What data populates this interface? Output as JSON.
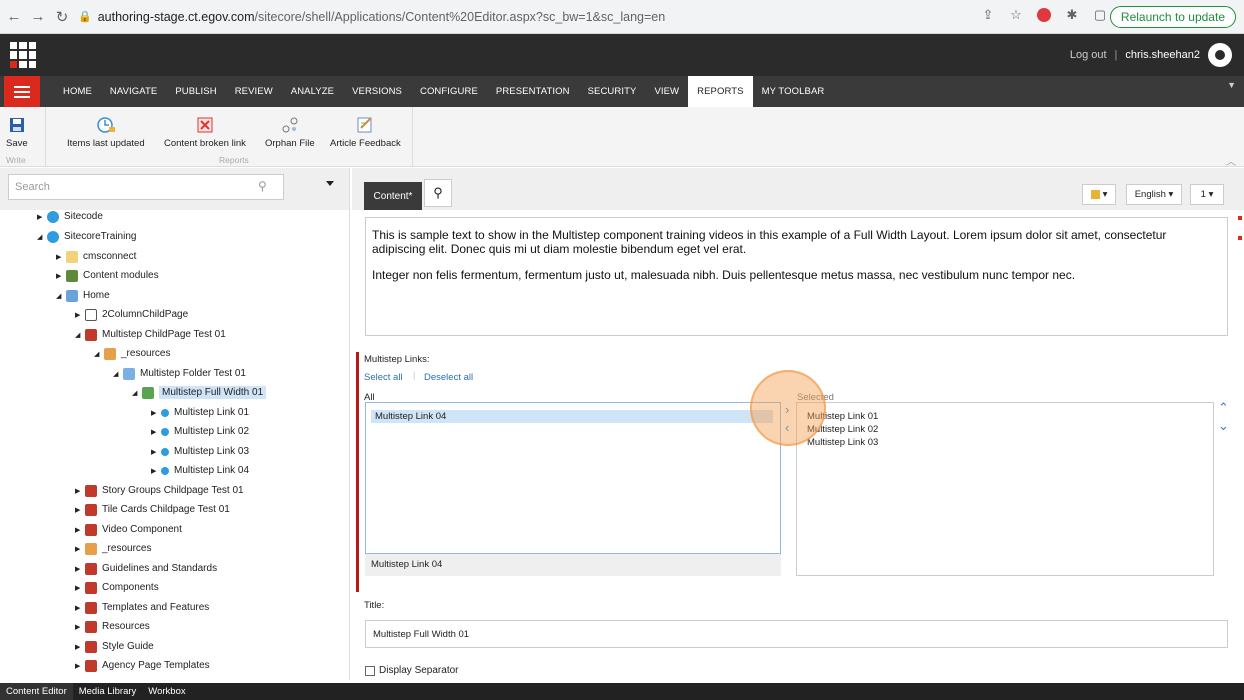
{
  "browser": {
    "url_host": "authoring-stage.ct.egov.com",
    "url_path": "/sitecore/shell/Applications/Content%20Editor.aspx?sc_bw=1&sc_lang=en",
    "relaunch_label": "Relaunch to update"
  },
  "header": {
    "logout_label": "Log out",
    "separator": "|",
    "username": "chris.sheehan2"
  },
  "ribbon_tabs": [
    "HOME",
    "NAVIGATE",
    "PUBLISH",
    "REVIEW",
    "ANALYZE",
    "VERSIONS",
    "CONFIGURE",
    "PRESENTATION",
    "SECURITY",
    "VIEW",
    "REPORTS",
    "MY TOOLBAR"
  ],
  "active_tab": "REPORTS",
  "ribbon": {
    "save_label": "Save",
    "write_group": "Write",
    "items_last_updated": "Items last updated",
    "content_broken_link": "Content broken link",
    "orphan_file": "Orphan File",
    "article_feedback": "Article Feedback",
    "reports_group": "Reports"
  },
  "tree": {
    "search_placeholder": "Search",
    "nodes": [
      {
        "label": "Sitecode"
      },
      {
        "label": "SitecoreTraining"
      },
      {
        "label": "cmsconnect"
      },
      {
        "label": "Content modules"
      },
      {
        "label": "Home"
      },
      {
        "label": "2ColumnChildPage"
      },
      {
        "label": "Multistep ChildPage Test 01"
      },
      {
        "label": "_resources"
      },
      {
        "label": "Multistep Folder Test 01"
      },
      {
        "label": "Multistep Full Width 01"
      },
      {
        "label": "Multistep Link 01"
      },
      {
        "label": "Multistep Link 02"
      },
      {
        "label": "Multistep Link 03"
      },
      {
        "label": "Multistep Link 04"
      },
      {
        "label": "Story Groups Childpage Test 01"
      },
      {
        "label": "Tile Cards Childpage Test 01"
      },
      {
        "label": "Video Component"
      },
      {
        "label": "_resources"
      },
      {
        "label": "Guidelines and Standards"
      },
      {
        "label": "Components"
      },
      {
        "label": "Templates and Features"
      },
      {
        "label": "Resources"
      },
      {
        "label": "Style Guide"
      },
      {
        "label": "Agency Page Templates"
      }
    ]
  },
  "editor": {
    "content_tab": "Content*",
    "language": "English",
    "version": "1",
    "body_p1": "This is sample text to show in the Multistep component training videos in this example of a Full Width Layout. Lorem ipsum dolor sit amet, consectetur adipiscing elit. Donec quis mi ut diam molestie bibendum eget vel erat.",
    "body_p2": "Integer non felis fermentum, fermentum justo ut, malesuada nibh. Duis pellentesque metus massa, nec vestibulum nunc tempor nec.",
    "multistep_label": "Multistep Links:",
    "select_all": "Select all",
    "deselect_all": "Deselect all",
    "all_label": "All",
    "selected_label": "Selected",
    "all_items": [
      "Multistep Link 04"
    ],
    "selected_items": [
      "Multistep Link 01",
      "Multistep Link 02",
      "Multistep Link 03"
    ],
    "all_footer": "Multistep Link 04",
    "title_label": "Title:",
    "title_value": "Multistep Full Width 01",
    "display_separator": "Display Separator"
  },
  "bottom_tabs": [
    "Content Editor",
    "Media Library",
    "Workbox"
  ]
}
